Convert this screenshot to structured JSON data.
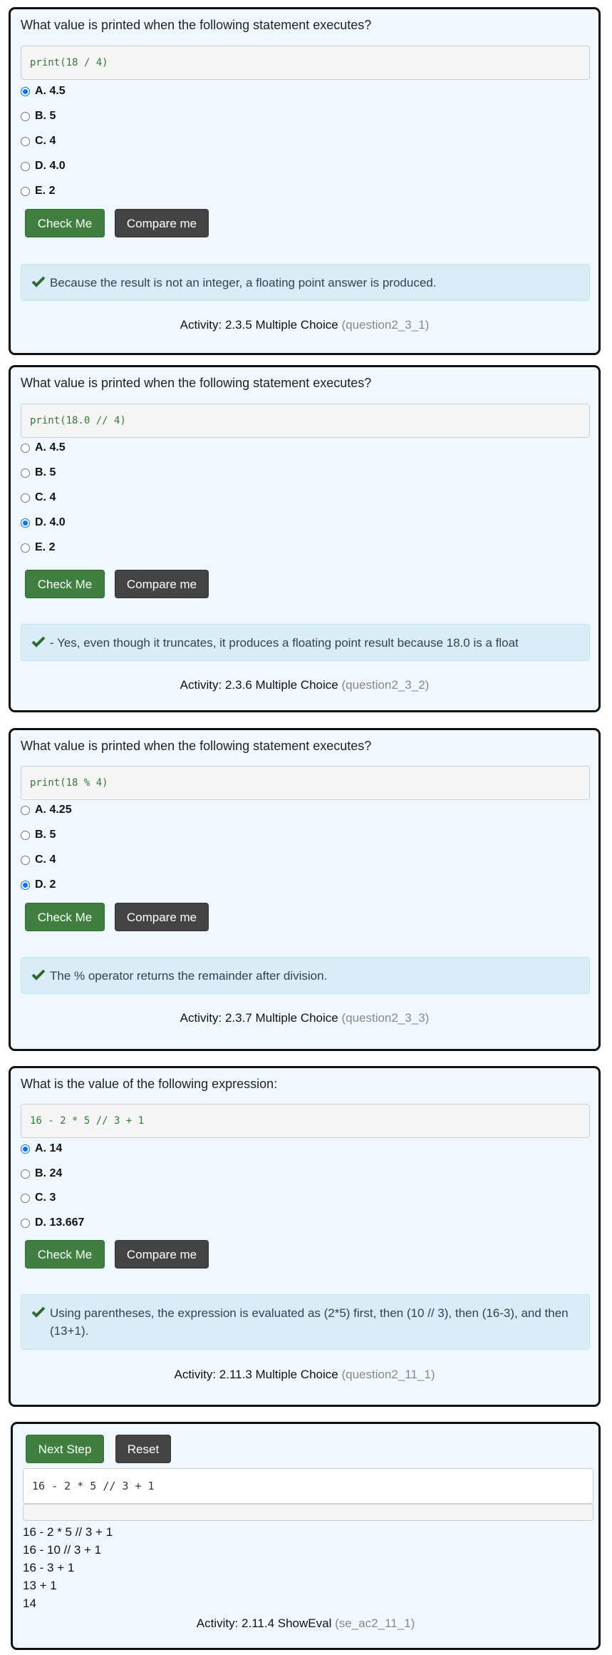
{
  "colors": {
    "card_bg": "#f0f8ff",
    "check_green": "#3f7f3f",
    "compare_dark": "#444444",
    "feedback_bg": "#d9edf7",
    "radio_blue": "#0075ff"
  },
  "icons": {
    "feedback": "checkmark-icon"
  },
  "q1": {
    "question": "What value is printed when the following statement executes?",
    "code": "print(18 / 4)",
    "options": [
      "A. 4.5",
      "B. 5",
      "C. 4",
      "D. 4.0",
      "E. 2"
    ],
    "selected": "A. 4.5",
    "check_label": "Check Me",
    "compare_label": "Compare me",
    "feedback": "Because the result is not an integer, a floating point answer is produced.",
    "activity": "Activity: 2.3.5 Multiple Choice",
    "activity_id": "(question2_3_1)"
  },
  "q2": {
    "question": "What value is printed when the following statement executes?",
    "code": "print(18.0 // 4)",
    "options": [
      "A. 4.5",
      "B. 5",
      "C. 4",
      "D. 4.0",
      "E. 2"
    ],
    "selected": "D. 4.0",
    "check_label": "Check Me",
    "compare_label": "Compare me",
    "feedback": "- Yes, even though it truncates, it produces a floating point result because 18.0 is a float",
    "activity": "Activity: 2.3.6 Multiple Choice",
    "activity_id": "(question2_3_2)"
  },
  "q3": {
    "question": "What value is printed when the following statement executes?",
    "code": "print(18 % 4)",
    "options": [
      "A. 4.25",
      "B. 5",
      "C. 4",
      "D. 2"
    ],
    "selected": "D. 2",
    "check_label": "Check Me",
    "compare_label": "Compare me",
    "feedback": "The % operator returns the remainder after division.",
    "activity": "Activity: 2.3.7 Multiple Choice",
    "activity_id": "(question2_3_3)"
  },
  "q4": {
    "question": "What is the value of the following expression:",
    "code": "16 - 2 * 5 // 3 + 1",
    "options": [
      "A. 14",
      "B. 24",
      "C. 3",
      "D. 13.667"
    ],
    "selected": "A. 14",
    "check_label": "Check Me",
    "compare_label": "Compare me",
    "feedback": "Using parentheses, the expression is evaluated as (2*5) first, then (10 // 3), then (16-3), and then (13+1).",
    "activity": "Activity: 2.11.3 Multiple Choice",
    "activity_id": "(question2_11_1)"
  },
  "showeval": {
    "next_label": "Next Step",
    "reset_label": "Reset",
    "expression": "16 - 2 * 5 // 3 + 1",
    "steps": [
      "16 - 2 * 5 // 3 + 1",
      "16 - 10 // 3 + 1",
      "16 - 3 + 1",
      "13 + 1",
      "14"
    ],
    "activity": "Activity: 2.11.4 ShowEval",
    "activity_id": "(se_ac2_11_1)"
  }
}
